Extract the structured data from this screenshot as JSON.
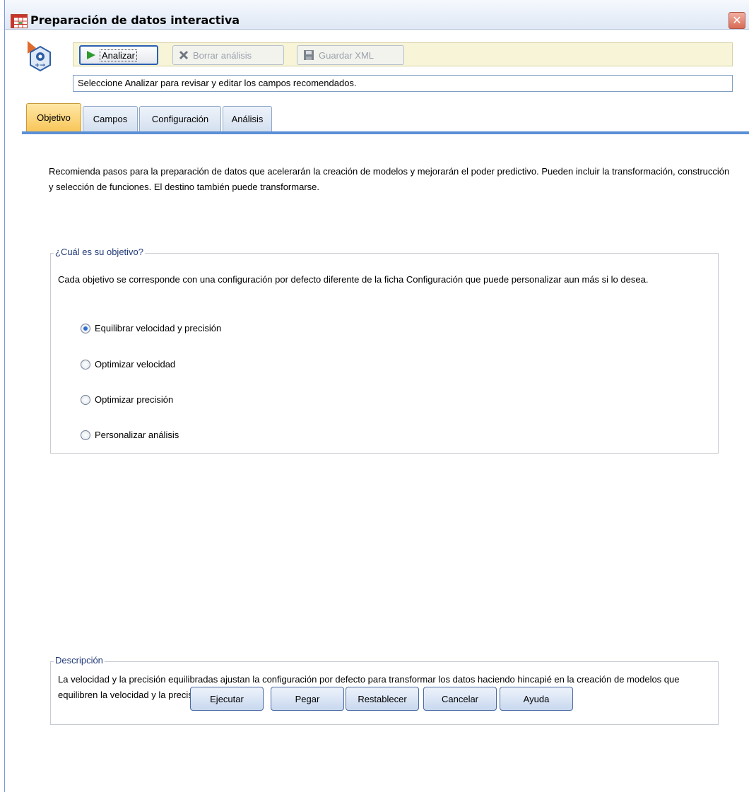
{
  "window": {
    "title": "Preparación de datos interactiva",
    "close_glyph": "✕"
  },
  "toolbar": {
    "analyze_label": "Analizar",
    "clear_label": "Borrar análisis",
    "save_label": "Guardar XML"
  },
  "status": {
    "message": "Seleccione Analizar para revisar y editar los campos recomendados."
  },
  "tabs": [
    {
      "label": "Objetivo",
      "selected": true
    },
    {
      "label": "Campos",
      "selected": false
    },
    {
      "label": "Configuración",
      "selected": false
    },
    {
      "label": "Análisis",
      "selected": false
    }
  ],
  "intro": {
    "text": "Recomienda pasos para la preparación de datos que acelerarán la creación de modelos y mejorarán el poder predictivo. Pueden incluir la transformación, construcción y selección de funciones. El destino también puede transformarse."
  },
  "objective_group": {
    "legend": "¿Cuál es su objetivo?",
    "text": "Cada objetivo se corresponde con una configuración por defecto diferente de la ficha Configuración que puede personalizar aun más si lo desea.",
    "options": [
      {
        "label": "Equilibrar velocidad y precisión",
        "checked": true
      },
      {
        "label": "Optimizar velocidad",
        "checked": false
      },
      {
        "label": "Optimizar precisión",
        "checked": false
      },
      {
        "label": "Personalizar análisis",
        "checked": false
      }
    ]
  },
  "description_group": {
    "legend": "Descripción",
    "text": "La velocidad y la precisión equilibradas ajustan la configuración por defecto para transformar los datos haciendo hincapié en la creación de modelos que equilibren la velocidad y la precisión."
  },
  "footer": {
    "run_label": "Ejecutar",
    "paste_label": "Pegar",
    "reset_label": "Restablecer",
    "cancel_label": "Cancelar",
    "help_label": "Ayuda"
  },
  "colors": {
    "selected_tab": "#f8c65a",
    "tab_strip": "#5b8fd6",
    "toolbar_bg": "#f7f4d8",
    "radio_dot": "#2e6bd1",
    "legend_text": "#203a78"
  }
}
